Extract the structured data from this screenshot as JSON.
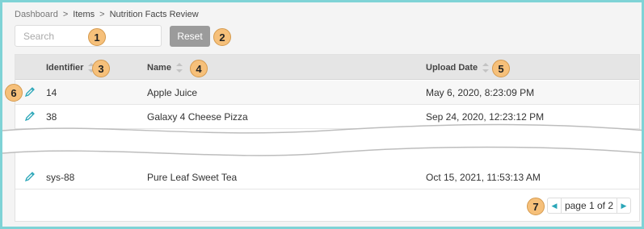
{
  "breadcrumb": {
    "items": [
      "Dashboard",
      "Items",
      "Nutrition Facts Review"
    ],
    "separator": ">"
  },
  "search": {
    "placeholder": "Search"
  },
  "reset_label": "Reset",
  "columns": {
    "identifier": "Identifier",
    "name": "Name",
    "upload_date": "Upload Date"
  },
  "rows": [
    {
      "id": "14",
      "name": "Apple Juice",
      "date": "May 6, 2020, 8:23:09 PM"
    },
    {
      "id": "38",
      "name": "Galaxy 4 Cheese Pizza",
      "date": "Sep 24, 2020, 12:23:12 PM"
    },
    {
      "id": "sys-88",
      "name": "Pure Leaf Sweet Tea",
      "date": "Oct 15, 2021, 11:53:13 AM"
    }
  ],
  "pagination": {
    "label": "page 1 of 2",
    "prev_icon": "chevron-left",
    "next_icon": "chevron-right"
  },
  "callouts": [
    "1",
    "2",
    "3",
    "4",
    "5",
    "6",
    "7"
  ],
  "colors": {
    "border": "#7fd3d6",
    "callout": "#f6c07a",
    "reset_bg": "#9b9b9b",
    "accent": "#2aa6b8"
  }
}
